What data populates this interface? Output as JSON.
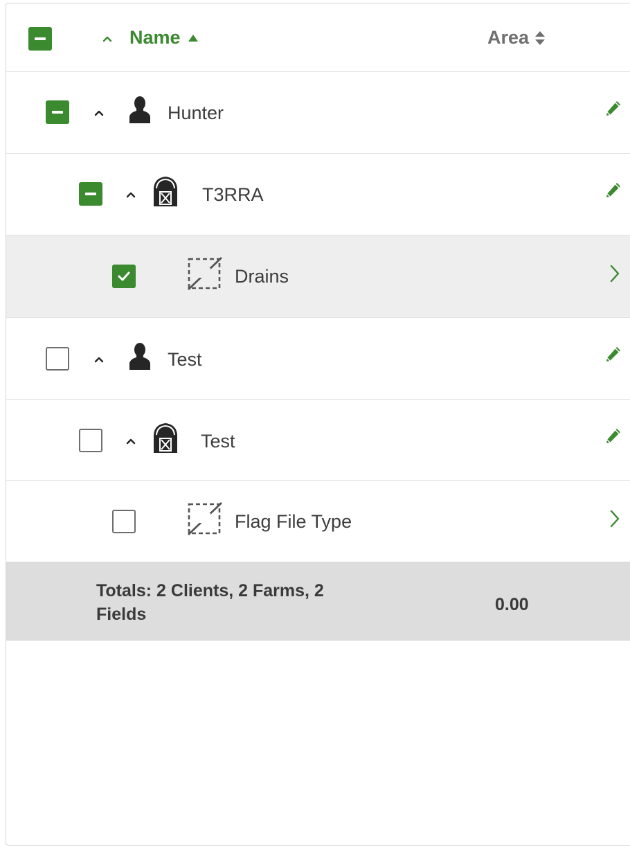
{
  "header": {
    "name_label": "Name",
    "area_label": "Area"
  },
  "rows": [
    {
      "label": "Hunter",
      "type": "client",
      "check_state": "partial",
      "action": "edit"
    },
    {
      "label": "T3RRA",
      "type": "farm",
      "check_state": "partial",
      "action": "edit"
    },
    {
      "label": "Drains",
      "type": "field",
      "check_state": "checked",
      "action": "open"
    },
    {
      "label": "Test",
      "type": "client",
      "check_state": "unchecked",
      "action": "edit"
    },
    {
      "label": "Test",
      "type": "farm",
      "check_state": "unchecked",
      "action": "edit"
    },
    {
      "label": "Flag File Type",
      "type": "field",
      "check_state": "unchecked",
      "action": "open"
    }
  ],
  "totals": {
    "label": "Totals: 2 Clients, 2 Farms, 2 Fields",
    "value": "0.00"
  },
  "icons": {
    "client": "person-icon",
    "farm": "barn-icon",
    "field": "field-boundary-icon",
    "edit": "pencil-icon",
    "open": "chevron-right-icon"
  },
  "colors": {
    "accent": "#3b8a2f",
    "selected_row": "#eeeeee",
    "totals_bg": "#dddddd"
  }
}
